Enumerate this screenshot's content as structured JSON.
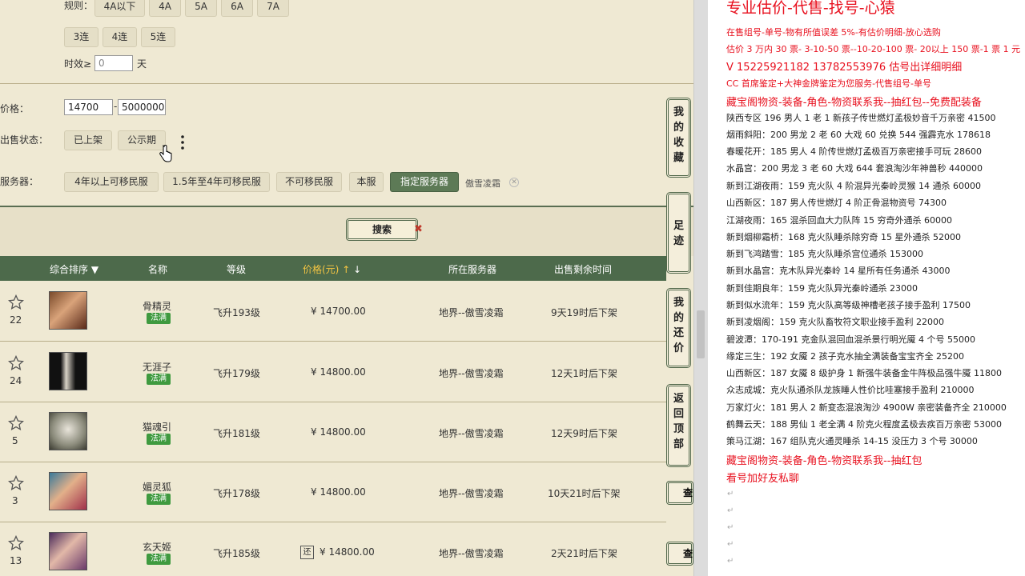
{
  "filters": {
    "rule_label": "规则：",
    "rule_options": [
      "4A以下",
      "4A",
      "5A",
      "6A",
      "7A"
    ],
    "lian_options": [
      "3连",
      "4连",
      "5连"
    ],
    "time_label": "时效≥",
    "time_value": "0",
    "time_unit": "天",
    "price_label": "价格：",
    "price_min": "14700",
    "price_sep": "-",
    "price_max": "5000000",
    "status_label": "出售状态：",
    "status_options": [
      "已上架",
      "公示期"
    ],
    "server_label": "服务器：",
    "server_options": [
      "4年以上可移民服",
      "1.5年至4年可移民服",
      "不可移民服",
      "本服",
      "指定服务器"
    ],
    "server_selected": "傲雪凌霜"
  },
  "search_button": "搜索",
  "table": {
    "headers": [
      "综合排序",
      "名称",
      "等级",
      "价格(元)",
      "所在服务器",
      "出售剩余时间"
    ],
    "rows": [
      {
        "fav": "22",
        "name": "骨精灵",
        "badge": "法满",
        "level": "飞升193级",
        "price": "¥ 14700.00",
        "server": "地界--傲雪凌霜",
        "remain": "9天19时后下架"
      },
      {
        "fav": "24",
        "name": "无涯子",
        "badge": "法满",
        "level": "飞升179级",
        "price": "¥ 14800.00",
        "server": "地界--傲雪凌霜",
        "remain": "12天1时后下架"
      },
      {
        "fav": "5",
        "name": "猫魂引",
        "badge": "法满",
        "level": "飞升181级",
        "price": "¥ 14800.00",
        "server": "地界--傲雪凌霜",
        "remain": "12天9时后下架"
      },
      {
        "fav": "3",
        "name": "媚灵狐",
        "badge": "法满",
        "level": "飞升178级",
        "price": "¥ 14800.00",
        "server": "地界--傲雪凌霜",
        "remain": "10天21时后下架"
      },
      {
        "fav": "13",
        "name": "玄天姬",
        "badge": "法满",
        "level": "飞升185级",
        "price": "¥ 14800.00",
        "server": "地界--傲雪凌霜",
        "remain": "2天21时后下架"
      }
    ],
    "row5_tag": "还"
  },
  "side_tabs": [
    "我的收藏",
    "足迹",
    "我的还价",
    "返回顶部"
  ],
  "check_label": "查",
  "notes": {
    "title": "专业估价-代售-找号-心猿",
    "lines": [
      {
        "text": "在售组号-单号-物有所值误差 5%-有估价明细-放心选购",
        "red": true
      },
      {
        "text": "估价 3 万内 30 票- 3-10-50 票--10-20-100 票- 20以上 150 票-1 票 1 元",
        "red": true
      },
      {
        "text": "V 15225921182    13782553976   估号出详细明细",
        "red": true,
        "big2": true
      },
      {
        "text": "CC 首席鉴定+大神金牌鉴定为您服务-代售组号-单号",
        "red": true
      },
      {
        "text": "藏宝阁物资-装备-角色-物资联系我--抽红包--免费配装备",
        "red": true,
        "big2": true
      },
      {
        "text": "陕西专区 196 男人 1 老 1 新孩子传世燃灯孟极妙音千万亲密 41500",
        "red": false
      },
      {
        "text": "烟雨斜阳：200 男龙 2 老 60 大戏 60 兑换 544 强霹克水 178618",
        "red": false
      },
      {
        "text": "春暖花开：185 男人 4 阶传世燃灯孟极百万亲密接手可玩 28600",
        "red": false
      },
      {
        "text": "水晶宫：200 男龙 3 老 60 大戏 644 套浪淘沙年神兽秒 440000",
        "red": false
      },
      {
        "text": "新到江湖夜雨：159 克火队 4 阶混异光秦岭灵猴 14 通杀 60000",
        "red": false
      },
      {
        "text": "山西新区：187 男人传世燃灯 4 阶正骨混物资号 74300",
        "red": false
      },
      {
        "text": "江湖夜雨：165 混杀回血大力队阵 15 穷奇外通杀 60000",
        "red": false
      },
      {
        "text": "新到烟柳霜桥：168 克火队睡杀除穷奇 15 星外通杀 52000",
        "red": false
      },
      {
        "text": "新到飞鸿踏雪：185 克火队睡杀宫位通杀 153000",
        "red": false
      },
      {
        "text": "新到水晶宫：克木队异光秦岭 14 星所有任务通杀 43000",
        "red": false
      },
      {
        "text": "新到佳期良年：159 克火队异光秦岭通杀 23000",
        "red": false
      },
      {
        "text": "新到似水流年：159 克火队高等级神槽老孩子接手盈利 17500",
        "red": false
      },
      {
        "text": "新到凌烟阁：159 克火队畜牧符文职业接手盈利 22000",
        "red": false
      },
      {
        "text": "碧波潭：170-191 克金队混回血混杀景行明光魇 4 个号 55000",
        "red": false
      },
      {
        "text": "缘定三生：192 女魇 2 孩子克水抽全满装备宝宝齐全 25200",
        "red": false
      },
      {
        "text": "山西新区：187 女魇 8 级护身 1 新强牛装备金牛阵极品强牛魇 11800",
        "red": false
      },
      {
        "text": "众志成城：克火队通杀队龙族睡人性价比哇塞接手盈利 210000",
        "red": false
      },
      {
        "text": "万家灯火：181 男人 2 新变态混浪淘沙 4900W 亲密装备齐全 210000",
        "red": false
      },
      {
        "text": "鹤舞云天：188 男仙 1 老全满 4 阶克火程度孟极去疾百万亲密 53000",
        "red": false
      },
      {
        "text": "策马江湖：167 组队克火通灵睡杀 14-15 没压力 3 个号 30000",
        "red": false
      },
      {
        "text": "藏宝阁物资-装备-角色-物资联系我--抽红包",
        "red": true,
        "big2": true
      },
      {
        "text": "看号加好友私聊",
        "red": true,
        "big2": true
      }
    ]
  },
  "colors": {
    "accent": "#4d6a4b",
    "red": "#e8101e",
    "badge": "#3f9a3f"
  }
}
